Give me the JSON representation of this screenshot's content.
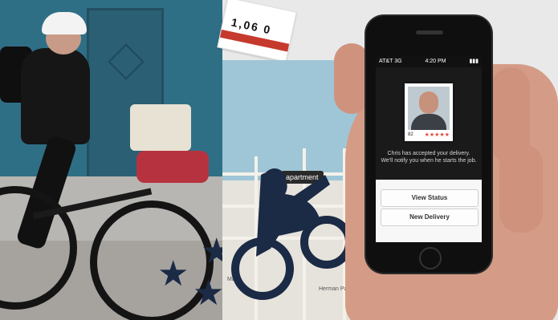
{
  "colors": {
    "left_background": "#2f6f86",
    "map_water": "#9fc6d6",
    "postmates_navy": "#1b2a45",
    "rating_star_red": "#e34a3a",
    "screen_background": "#f7f7f7"
  },
  "ticket": {
    "number": "1,06  0"
  },
  "map": {
    "pin_label": "apartment",
    "labels": [
      "Ma…",
      "Herman Park"
    ]
  },
  "phone": {
    "status": {
      "carrier": "AT&T",
      "network": "3G",
      "time": "4:20 PM",
      "battery": "▮▮▮"
    },
    "courier": {
      "rating_number": "82",
      "stars": "★★★★★"
    },
    "message_line1": "Chris has accepted your delivery.",
    "message_line2": "We'll notify you when he starts the job.",
    "buttons": {
      "view_status": "View Status",
      "new_delivery": "New Delivery"
    }
  }
}
